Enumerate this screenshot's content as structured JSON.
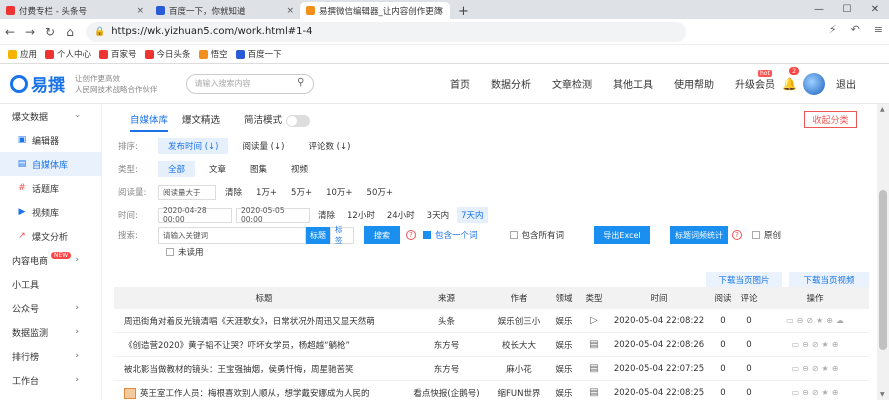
{
  "browser": {
    "tabs": [
      {
        "label": "付费专栏 - 头条号",
        "color": "#e33"
      },
      {
        "label": "百度一下，你就知道",
        "color": "#2a5bd7"
      },
      {
        "label": "易撰微信编辑器_让内容创作更简",
        "color": "#f38f1c"
      }
    ],
    "url": "https://wk.yizhuan5.com/work.html#1-4",
    "bookmarks": [
      "应用",
      "个人中心",
      "百家号",
      "今日头条",
      "悟空",
      "百度一下"
    ]
  },
  "header": {
    "logo": "易撰",
    "slogan": [
      "让创作更高效",
      "人民网技术战略合作伙伴"
    ],
    "search_placeholder": "请输入搜索内容",
    "nav": [
      "首页",
      "数据分析",
      "文章检测",
      "其他工具",
      "使用帮助",
      "升级会员"
    ],
    "hot_badge": "hot",
    "notif_count": "2",
    "logout": "退出"
  },
  "sidebar": {
    "items": [
      {
        "label": "爆文数据",
        "type": "group"
      },
      {
        "label": "编辑器",
        "icon": "▣",
        "type": "sub"
      },
      {
        "label": "自媒体库",
        "icon": "▤",
        "type": "sub",
        "active": true
      },
      {
        "label": "话题库",
        "icon": "#",
        "type": "sub"
      },
      {
        "label": "视频库",
        "icon": "▶",
        "type": "sub"
      },
      {
        "label": "爆文分析",
        "icon": "↗",
        "type": "sub"
      },
      {
        "label": "内容电商",
        "type": "group",
        "new": "NEW"
      },
      {
        "label": "小工具",
        "type": "group"
      },
      {
        "label": "公众号",
        "type": "group"
      },
      {
        "label": "数据监测",
        "type": "group"
      },
      {
        "label": "排行榜",
        "type": "group"
      },
      {
        "label": "工作台",
        "type": "group"
      }
    ]
  },
  "main": {
    "tabs": [
      "自媒体库",
      "爆文精选",
      "简洁模式"
    ],
    "collect": "收起分类",
    "sort": {
      "label": "排序:",
      "options": [
        "发布时间 (↓)",
        "阅读量 (↓)",
        "评论数 (↓)"
      ]
    },
    "type": {
      "label": "类型:",
      "options": [
        "全部",
        "文章",
        "图集",
        "视频"
      ]
    },
    "reads": {
      "label": "阅读量:",
      "placeholder": "阅读量大于",
      "options": [
        "清除",
        "1万+",
        "5万+",
        "10万+",
        "50万+"
      ]
    },
    "time": {
      "label": "时间:",
      "from": "2020-04-28 00:00",
      "to": "2020-05-05 00:00",
      "options": [
        "清除",
        "12小时",
        "24小时",
        "3天内",
        "7天内"
      ]
    },
    "search": {
      "label": "搜索:",
      "placeholder": "请输入关键词",
      "mode_title": "标题",
      "mode_tag": "标签",
      "button": "搜索",
      "include_one": "包含一个词",
      "include_all": "包含所有词",
      "export": "导出Excel",
      "stats": "标题词频统计",
      "original": "原创",
      "unread": "未读用"
    },
    "download_img": "下载当页图片",
    "download_video": "下载当页视频",
    "columns": [
      "标题",
      "来源",
      "作者",
      "领域",
      "类型",
      "时间",
      "阅读",
      "评论",
      "操作"
    ],
    "rows": [
      {
        "title": "周迅街角对着反光镜清唱《天涯歌女》，日常状况外周迅又显天然萌",
        "source": "头条",
        "author": "娱乐创三小",
        "domain": "娱乐",
        "type": "video",
        "time": "2020-05-04 22:08:22",
        "read": "0",
        "comment": "0"
      },
      {
        "title": "《创造营2020》黄子韬不让哭？吓坏女学员，杨超越“躺枪”",
        "source": "东方号",
        "author": "校长大大",
        "domain": "娱乐",
        "type": "article",
        "time": "2020-05-04 22:08:26",
        "read": "0",
        "comment": "0"
      },
      {
        "title": "被北影当做教材的镜头：王宝强抽烟，侯勇忏悔，周星驰苦笑",
        "source": "东方号",
        "author": "麻小花",
        "domain": "娱乐",
        "type": "article",
        "time": "2020-05-04 22:07:25",
        "read": "0",
        "comment": "0"
      },
      {
        "title": "英王室工作人员：梅根喜欢别人顺从，想学戴安娜成为人民的",
        "source": "看点快报(企鹅号)",
        "author": "缩FUN世界",
        "domain": "娱乐",
        "type": "article",
        "time": "2020-05-04 22:08:25",
        "read": "0",
        "comment": "0"
      }
    ]
  }
}
